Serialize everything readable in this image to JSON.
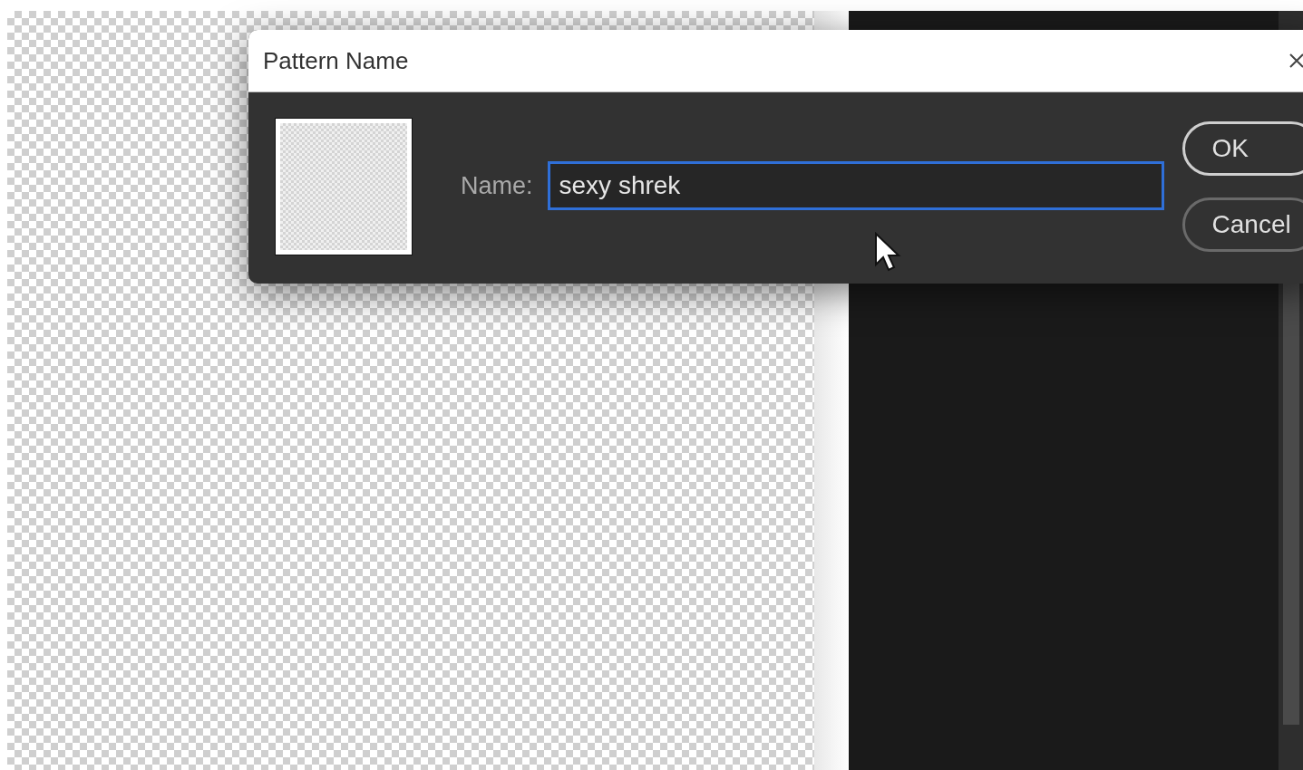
{
  "dialog": {
    "title": "Pattern Name",
    "name_label": "Name:",
    "name_field": {
      "value": "sexy shrek",
      "focused": true
    },
    "buttons": [
      {
        "label": "OK",
        "default": true
      },
      {
        "label": "Cancel",
        "default": false
      }
    ]
  }
}
